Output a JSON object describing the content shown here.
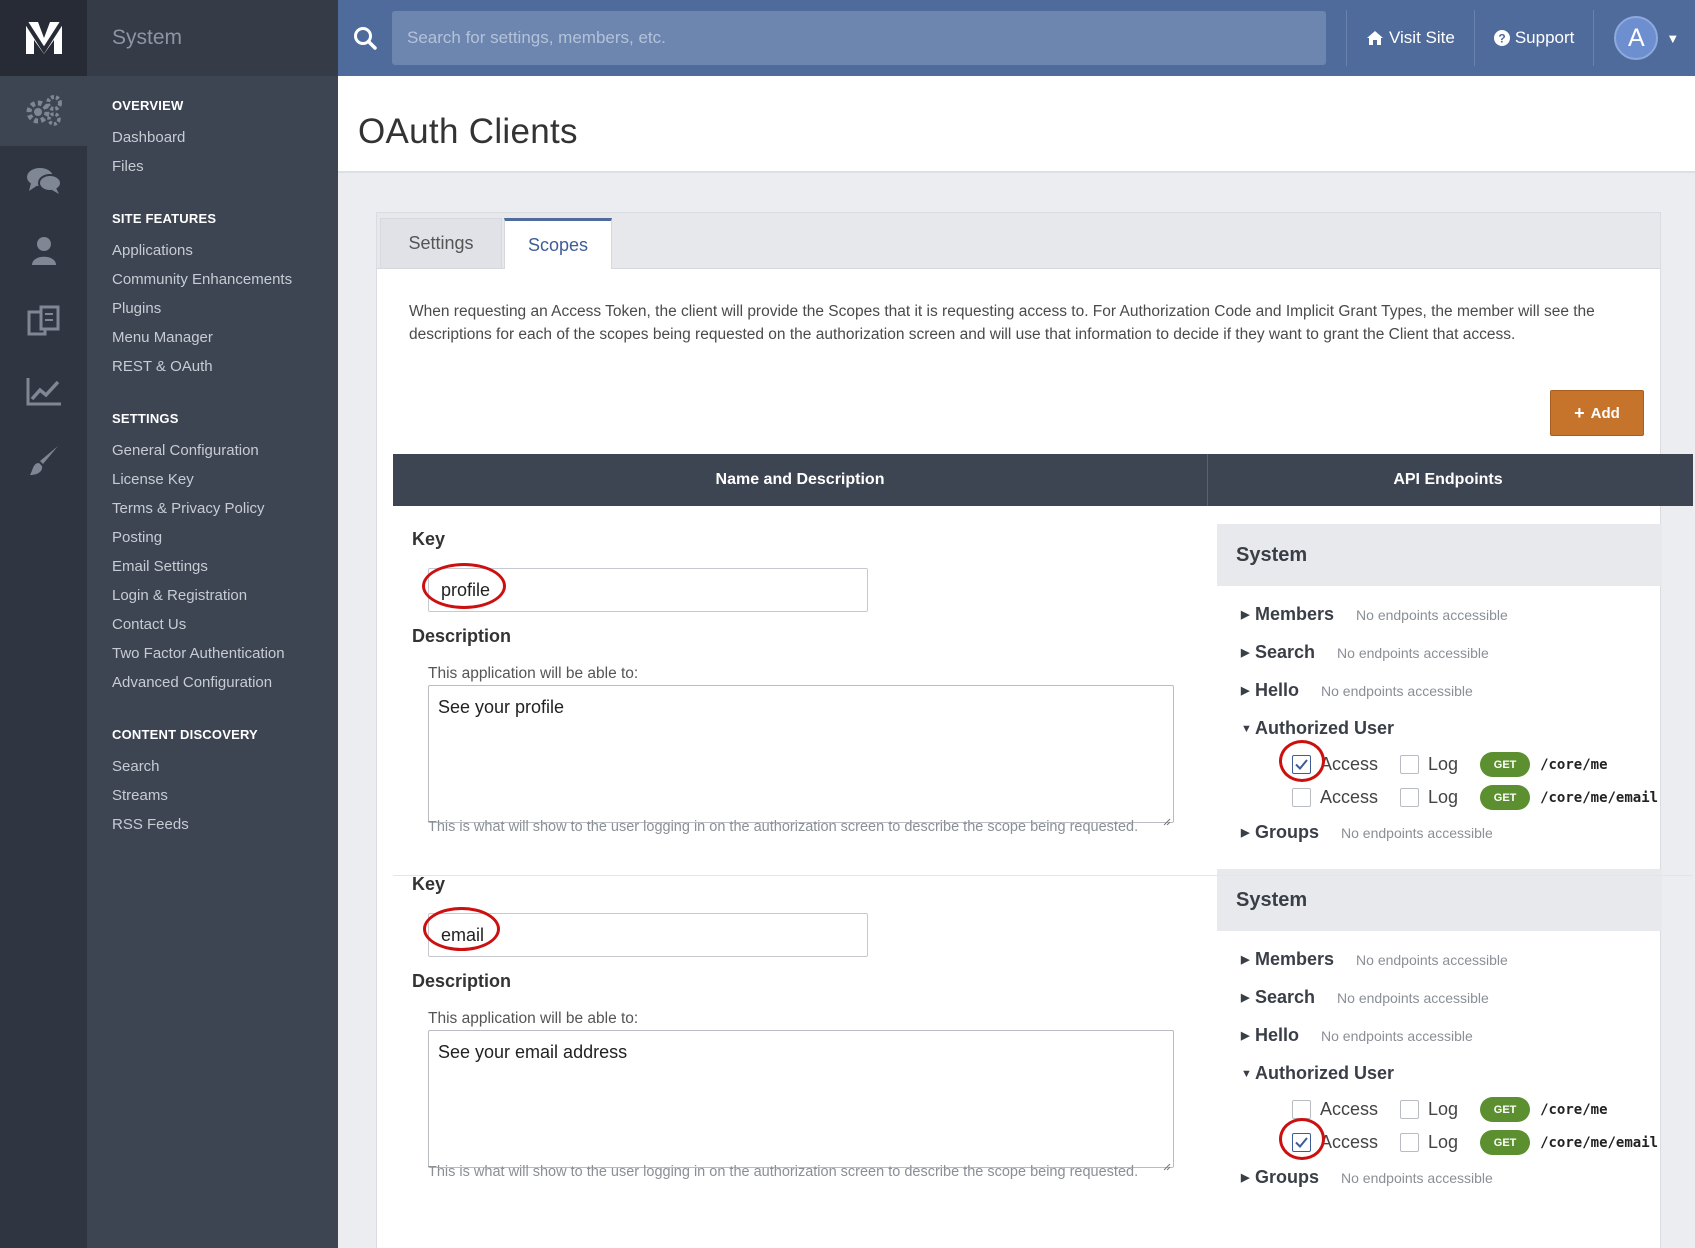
{
  "app": {
    "section_title": "System"
  },
  "rail": {
    "icons": [
      "logo-icon",
      "gears-icon",
      "chat-icon",
      "user-icon",
      "pages-icon",
      "chart-icon",
      "brush-icon"
    ]
  },
  "nav": {
    "sections": [
      {
        "title": "OVERVIEW",
        "items": [
          "Dashboard",
          "Files"
        ]
      },
      {
        "title": "SITE FEATURES",
        "items": [
          "Applications",
          "Community Enhancements",
          "Plugins",
          "Menu Manager",
          "REST & OAuth"
        ]
      },
      {
        "title": "SETTINGS",
        "items": [
          "General Configuration",
          "License Key",
          "Terms & Privacy Policy",
          "Posting",
          "Email Settings",
          "Login & Registration",
          "Contact Us",
          "Two Factor Authentication",
          "Advanced Configuration"
        ]
      },
      {
        "title": "CONTENT DISCOVERY",
        "items": [
          "Search",
          "Streams",
          "RSS Feeds"
        ]
      }
    ]
  },
  "topbar": {
    "search_placeholder": "Search for settings, members, etc.",
    "visit_site": "Visit Site",
    "support": "Support",
    "avatar_letter": "A"
  },
  "page": {
    "title": "OAuth Clients"
  },
  "tabs": [
    {
      "label": "Settings",
      "active": false
    },
    {
      "label": "Scopes",
      "active": true
    }
  ],
  "intro": "When requesting an Access Token, the client will provide the Scopes that it is requesting access to. For Authorization Code and Implicit Grant Types, the member will see the descriptions for each of the scopes being requested on the authorization screen and will use that information to decide if they want to grant the Client that access.",
  "add_button": "Add",
  "table": {
    "col1": "Name and Description",
    "col2": "API Endpoints"
  },
  "labels": {
    "key": "Key",
    "description": "Description",
    "able_to": "This application will be able to:",
    "note": "This is what will show to the user logging in on the authorization screen to describe the scope being requested.",
    "system": "System",
    "no_endpoints": "No endpoints accessible",
    "access": "Access",
    "log": "Log",
    "get": "GET"
  },
  "scopes": [
    {
      "key": "profile",
      "description": "See your profile",
      "groups": [
        "Members",
        "Search",
        "Hello",
        "Authorized User",
        "Groups"
      ],
      "endpoints": [
        {
          "path": "/core/me",
          "access": true,
          "log": false
        },
        {
          "path": "/core/me/email",
          "access": false,
          "log": false
        }
      ]
    },
    {
      "key": "email",
      "description": "See your email address",
      "groups": [
        "Members",
        "Search",
        "Hello",
        "Authorized User",
        "Groups"
      ],
      "endpoints": [
        {
          "path": "/core/me",
          "access": false,
          "log": false
        },
        {
          "path": "/core/me/email",
          "access": true,
          "log": false
        }
      ]
    }
  ],
  "colors": {
    "accent": "#4e6b9c",
    "add_button": "#c6732b",
    "get_badge": "#5c8f30",
    "annotation": "#cc1010"
  }
}
